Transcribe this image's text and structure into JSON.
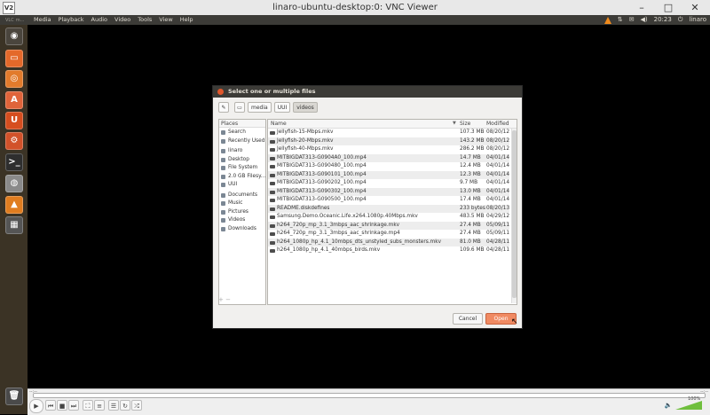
{
  "vnc": {
    "logo": "V2",
    "title": "linaro-ubuntu-desktop:0: VNC Viewer",
    "minimize": "–",
    "maximize": "□",
    "close": "✕"
  },
  "panel": {
    "app": "VLC",
    "app_sub": "m...",
    "menus": [
      "Media",
      "Playback",
      "Audio",
      "Video",
      "Tools",
      "View",
      "Help"
    ],
    "time": "20:23",
    "user": "linaro",
    "icons": [
      "vlc-cone-icon",
      "transfer-icon",
      "mail-icon",
      "volume-icon",
      "clock",
      "power-icon"
    ]
  },
  "launcher": {
    "items": [
      {
        "name": "dash-icon",
        "glyph": "◉",
        "color": "#4a453d"
      },
      {
        "name": "files-icon",
        "glyph": "▭",
        "color": "#e4692a"
      },
      {
        "name": "firefox-icon",
        "glyph": "◎",
        "color": "#e27b2c"
      },
      {
        "name": "software-center-icon",
        "glyph": "A",
        "color": "#e0643a"
      },
      {
        "name": "ubuntu-one-icon",
        "glyph": "U",
        "color": "#d64e1f"
      },
      {
        "name": "settings-icon",
        "glyph": "⚙",
        "color": "#d2522a"
      },
      {
        "name": "terminal-icon",
        "glyph": ">_",
        "color": "#2e2e2e"
      },
      {
        "name": "disk-utility-icon",
        "glyph": "◍",
        "color": "#8a8a8a"
      },
      {
        "name": "vlc-icon",
        "glyph": "▲",
        "color": "#e07d20"
      },
      {
        "name": "workspace-switcher-icon",
        "glyph": "▦",
        "color": "#555555"
      },
      {
        "name": "trash-icon",
        "glyph": "🗑",
        "color": "#4a4a4a"
      }
    ]
  },
  "controls": {
    "elapsed": "--:--",
    "total": "--:--",
    "volume": "100%"
  },
  "dialog": {
    "title": "Select one or multiple files",
    "path": [
      "media",
      "UUI",
      "videos"
    ],
    "places_header": "Places",
    "places": [
      {
        "label": "Search",
        "gap": false
      },
      {
        "label": "Recently Used",
        "gap": false
      },
      {
        "label": "linaro",
        "gap": true
      },
      {
        "label": "Desktop",
        "gap": false
      },
      {
        "label": "File System",
        "gap": false
      },
      {
        "label": "2.0 GB Filesy...",
        "gap": false
      },
      {
        "label": "UUI",
        "gap": false
      },
      {
        "label": "Documents",
        "gap": true
      },
      {
        "label": "Music",
        "gap": false
      },
      {
        "label": "Pictures",
        "gap": false
      },
      {
        "label": "Videos",
        "gap": false
      },
      {
        "label": "Downloads",
        "gap": false
      }
    ],
    "places_footer": "+ −",
    "columns": {
      "name": "Name",
      "size": "Size",
      "modified": "Modified"
    },
    "files": [
      {
        "name": "Jellyfish-15-Mbps.mkv",
        "size": "107.3 MB",
        "modified": "08/20/12"
      },
      {
        "name": "Jellyfish-20-Mbps.mkv",
        "size": "143.2 MB",
        "modified": "08/20/12"
      },
      {
        "name": "Jellyfish-40-Mbps.mkv",
        "size": "286.2 MB",
        "modified": "08/20/12"
      },
      {
        "name": "MITBIGDAT313-G0904A0_100.mp4",
        "size": "14.7 MB",
        "modified": "04/01/14"
      },
      {
        "name": "MITBIGDAT313-G090480_100.mp4",
        "size": "12.4 MB",
        "modified": "04/01/14"
      },
      {
        "name": "MITBIGDAT313-G090101_100.mp4",
        "size": "12.3 MB",
        "modified": "04/01/14"
      },
      {
        "name": "MITBIGDAT313-G090202_100.mp4",
        "size": "9.7 MB",
        "modified": "04/01/14"
      },
      {
        "name": "MITBIGDAT313-G090302_100.mp4",
        "size": "13.0 MB",
        "modified": "04/01/14"
      },
      {
        "name": "MITBIGDAT313-G090500_100.mp4",
        "size": "17.4 MB",
        "modified": "04/01/14"
      },
      {
        "name": "README.diskdefines",
        "size": "233 bytes",
        "modified": "08/20/13"
      },
      {
        "name": "Samsung.Demo.Oceanic.Life.x264.1080p.40Mbps.mkv",
        "size": "483.5 MB",
        "modified": "04/29/12"
      },
      {
        "name": "h264_720p_mp_3.1_3mbps_aac_shrinkage.mkv",
        "size": "27.4 MB",
        "modified": "05/09/11"
      },
      {
        "name": "h264_720p_mp_3.1_3mbps_aac_shrinkage.mp4",
        "size": "27.4 MB",
        "modified": "05/09/11"
      },
      {
        "name": "h264_1080p_hp_4.1_10mbps_dts_unstyled_subs_monsters.mkv",
        "size": "81.0 MB",
        "modified": "04/28/11"
      },
      {
        "name": "h264_1080p_hp_4.1_40mbps_birds.mkv",
        "size": "109.6 MB",
        "modified": "04/28/11"
      }
    ],
    "cancel": "Cancel",
    "open": "Open"
  }
}
